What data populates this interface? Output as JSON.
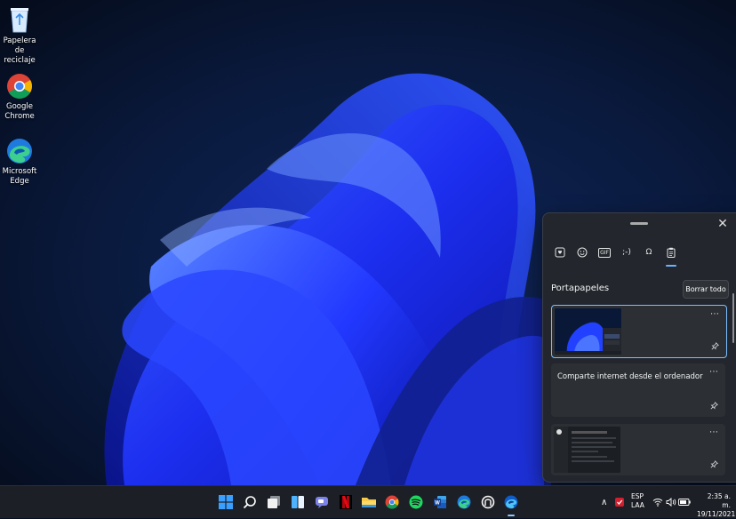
{
  "desktop": {
    "icons": [
      {
        "label": "Papelera de reciclaje",
        "icon": "recycle-bin-icon"
      },
      {
        "label": "Google Chrome",
        "icon": "chrome-icon"
      },
      {
        "label": "Microsoft Edge",
        "icon": "edge-icon"
      }
    ]
  },
  "clipboard_panel": {
    "tabs": [
      {
        "icon": "heart-sticker-icon"
      },
      {
        "icon": "emoji-icon"
      },
      {
        "icon": "gif-icon",
        "label": "GIF"
      },
      {
        "icon": "kaomoji-icon",
        "label": ";-)"
      },
      {
        "icon": "symbols-icon",
        "label": "Ω"
      },
      {
        "icon": "clipboard-icon"
      }
    ],
    "active_tab": "clipboard",
    "section_title": "Portapapeles",
    "clear_all_label": "Borrar todo",
    "items": [
      {
        "type": "image",
        "more": "⋯",
        "pin": "⊿"
      },
      {
        "type": "text",
        "text": "Comparte internet desde el ordenador",
        "more": "⋯",
        "pin": "⊿"
      },
      {
        "type": "image",
        "more": "⋯",
        "pin": "⊿"
      }
    ],
    "close_label": "✕"
  },
  "taskbar": {
    "icons": [
      "windows-start-icon",
      "search-icon",
      "task-view-icon",
      "widgets-icon",
      "teams-chat-icon",
      "netflix-icon",
      "file-explorer-icon",
      "chrome-icon",
      "spotify-icon",
      "word-icon",
      "edge-icon",
      "system-icon",
      "edge-dev-icon"
    ],
    "tray": {
      "overflow": "∧",
      "lang_line1": "ESP",
      "lang_line2": "LAA",
      "time": "2:35 a. m.",
      "date": "19/11/2021"
    }
  },
  "colors": {
    "accent": "#7bbdff",
    "wallpaper_blue": "#1b3cff"
  }
}
